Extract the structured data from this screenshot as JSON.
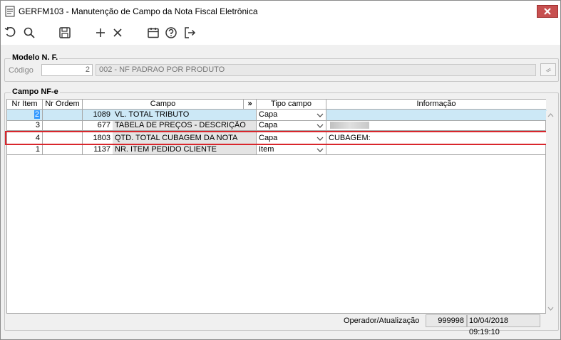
{
  "window": {
    "title": "GERFM103 - Manutenção de Campo da Nota Fiscal Eletrônica",
    "close_icon": "close-icon"
  },
  "toolbar": {
    "icons": [
      "undo-icon",
      "search-icon",
      "save-icon",
      "add-icon",
      "delete-icon",
      "calendar-icon",
      "help-icon",
      "exit-icon"
    ]
  },
  "modelo": {
    "group_title": "Modelo N. F.",
    "codigo_label": "Código",
    "codigo_value": "2",
    "descricao_value": "002 - NF PADRAO POR PRODUTO"
  },
  "campo_nfe": {
    "group_title": "Campo NF-e",
    "columns": {
      "nr_item": "Nr Item",
      "nr_ordem": "Nr Ordem",
      "campo": "Campo",
      "expand": "»",
      "tipo_campo": "Tipo campo",
      "informacao": "Informação"
    },
    "rows": [
      {
        "nr_item": "2",
        "nr_ordem": "",
        "campo_code": "1089",
        "campo_desc": "VL. TOTAL TRIBUTO",
        "tipo": "Capa",
        "info": ""
      },
      {
        "nr_item": "3",
        "nr_ordem": "",
        "campo_code": "677",
        "campo_desc": "TABELA DE PREÇOS - DESCRIÇÃO",
        "tipo": "Capa",
        "info": ""
      },
      {
        "nr_item": "4",
        "nr_ordem": "",
        "campo_code": "1803",
        "campo_desc": "QTD. TOTAL CUBAGEM DA NOTA",
        "tipo": "Capa",
        "info": "CUBAGEM:"
      },
      {
        "nr_item": "1",
        "nr_ordem": "",
        "campo_code": "1137",
        "campo_desc": "NR. ITEM PEDIDO CLIENTE",
        "tipo": "Item",
        "info": ""
      }
    ]
  },
  "footer": {
    "label": "Operador/Atualização",
    "operador": "999998",
    "atualizacao": "10/04/2018 09:19:10"
  },
  "colors": {
    "selected_row": "#cce8f6",
    "highlight_border": "#d9262c",
    "close_button": "#c75050"
  }
}
